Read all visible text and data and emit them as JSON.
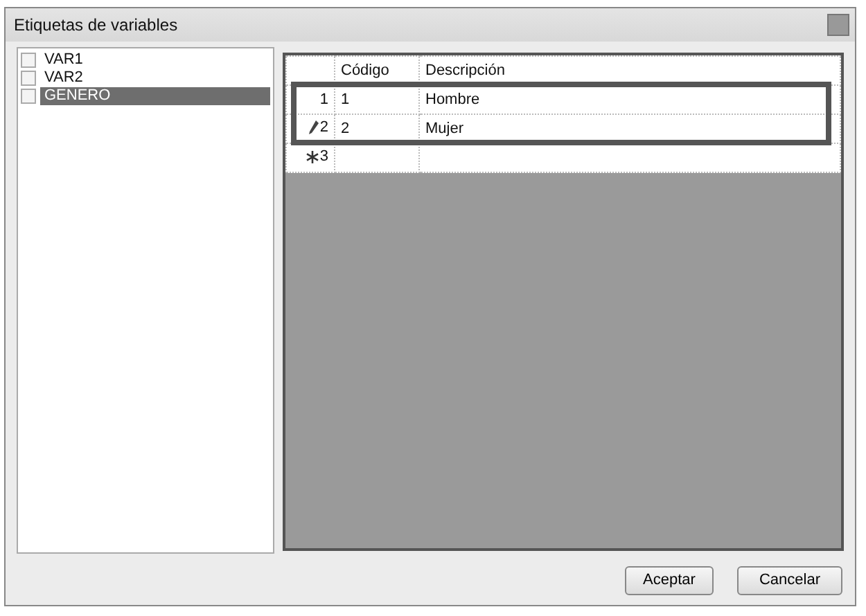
{
  "window": {
    "title": "Etiquetas de variables"
  },
  "variables": [
    {
      "name": "VAR1",
      "checked": false,
      "selected": false
    },
    {
      "name": "VAR2",
      "checked": false,
      "selected": false
    },
    {
      "name": "GENERO",
      "checked": false,
      "selected": true
    }
  ],
  "table": {
    "columns": [
      "Código",
      "Descripción"
    ],
    "rows": [
      {
        "kind": "data",
        "header": "1",
        "cells": [
          "1",
          "Hombre"
        ],
        "highlighted": true
      },
      {
        "kind": "editing",
        "header": "2",
        "cells": [
          "2",
          "Mujer"
        ],
        "highlighted": true
      },
      {
        "kind": "new",
        "header": "3",
        "cells": [
          "",
          ""
        ],
        "highlighted": false
      }
    ]
  },
  "buttons": [
    "Aceptar",
    "Cancelar"
  ]
}
